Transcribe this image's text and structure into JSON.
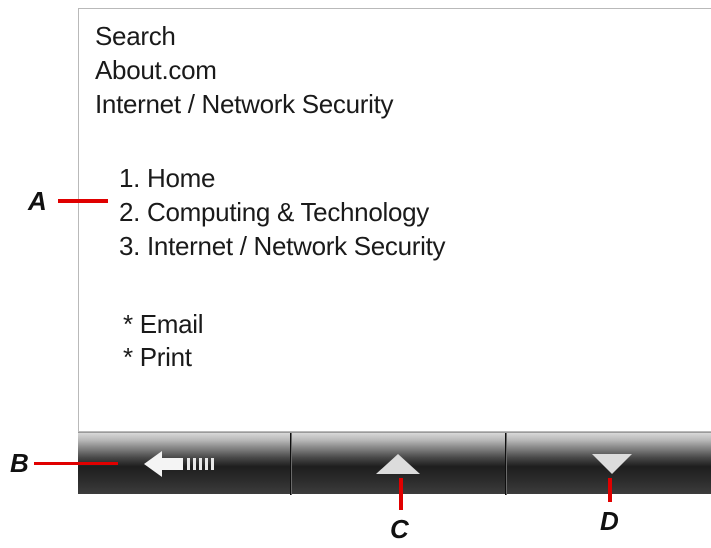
{
  "screen": {
    "header_lines": [
      "Search",
      "About.com",
      "Internet / Network Security"
    ],
    "breadcrumb_items": [
      "1. Home",
      "2. Computing & Technology",
      "3. Internet / Network Security"
    ],
    "action_links": [
      "* Email",
      "* Print"
    ]
  },
  "toolbar": {
    "back_icon": "left-arrow-icon",
    "up_icon": "up-triangle-icon",
    "down_icon": "down-triangle-icon"
  },
  "callouts": {
    "a": "A",
    "b": "B",
    "c": "C",
    "d": "D"
  },
  "colors": {
    "callout_line": "#e00000",
    "icon": "#dcdcdc"
  }
}
